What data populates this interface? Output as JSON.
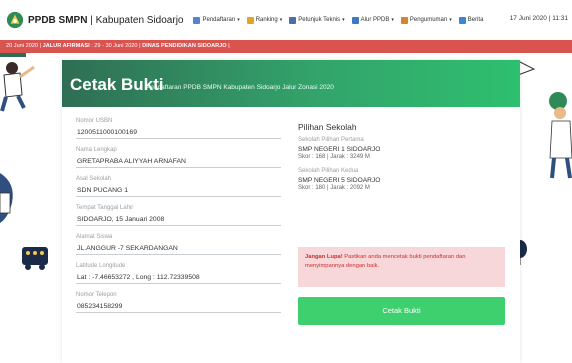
{
  "brand": {
    "name": "PPDB SMPN",
    "region": "Kabupaten Sidoarjo"
  },
  "menu": [
    {
      "label": "Pendaftaran",
      "icon": "register-icon",
      "color": "#5b7fd1",
      "has_caret": true
    },
    {
      "label": "Ranking",
      "icon": "trophy-icon",
      "color": "#e0a526",
      "has_caret": true
    },
    {
      "label": "Petunjuk Teknis",
      "icon": "book-icon",
      "color": "#4a6ea8",
      "has_caret": true
    },
    {
      "label": "Alur PPDB",
      "icon": "flow-icon",
      "color": "#3b7bbf",
      "has_caret": true
    },
    {
      "label": "Pengumuman",
      "icon": "megaphone-icon",
      "color": "#d9822b",
      "has_caret": true
    },
    {
      "label": "Berita",
      "icon": "news-icon",
      "color": "#3a86d4",
      "has_caret": false
    }
  ],
  "clock": "17 Juni 2020 | 11:31",
  "ticker": {
    "text_before": "20 Juni 2020 | ",
    "bold1": "JALUR AFIRMASI",
    "middle": " : 29 - 30 Juni 2020 | ",
    "bold2": "DINAS PENDIDIKAN SIDOARJO",
    "text_after": " |"
  },
  "card": {
    "title": "Cetak Bukti",
    "subtitle": "Pendaftaran PPDB SMPN Kabupaten Sidoarjo Jalur Zonasi 2020"
  },
  "fields": [
    {
      "label": "Nomor USBN",
      "value": "1200511000100169"
    },
    {
      "label": "Nama Lengkap",
      "value": "GRETAPRABA ALIYYAH ARNAFAN"
    },
    {
      "label": "Asal Sekolah",
      "value": "SDN PUCANG 1"
    },
    {
      "label": "Tempat Tanggal Lahir",
      "value": "SIDOARJO, 15 Januari 2008"
    },
    {
      "label": "Alamat Siswa",
      "value": "JL.ANGGUR -7 SEKARDANGAN"
    },
    {
      "label": "Latitude Longitude",
      "value": "Lat : -7.46653272 , Long : 112.72339508"
    },
    {
      "label": "Nomor Telepon",
      "value": "085234158299"
    }
  ],
  "schools": {
    "title": "Pilihan Sekolah",
    "first": {
      "label": "Sekolah Pilihan Pertama",
      "name": "SMP NEGERI 1 SIDOARJO",
      "score": "Skor : 168 | Jarak : 3249 M"
    },
    "second": {
      "label": "Sekolah Pilihan Kedua",
      "name": "SMP NEGERI 5 SIDOARJO",
      "score": "Skor : 180 | Jarak : 2092 M"
    }
  },
  "alert": {
    "bold": "Jangan Lupa!",
    "text": " Pastikan anda mencetak bukti pendaftaran dan menyimpannya dengan baik."
  },
  "print_button": {
    "label": "Cetak Bukti"
  },
  "colors": {
    "accent_green": "#33a36b",
    "button_green": "#3ecf6e",
    "ticker_red": "#d9534f",
    "alert_bg": "#f8d7da",
    "alert_text": "#c9302c"
  }
}
